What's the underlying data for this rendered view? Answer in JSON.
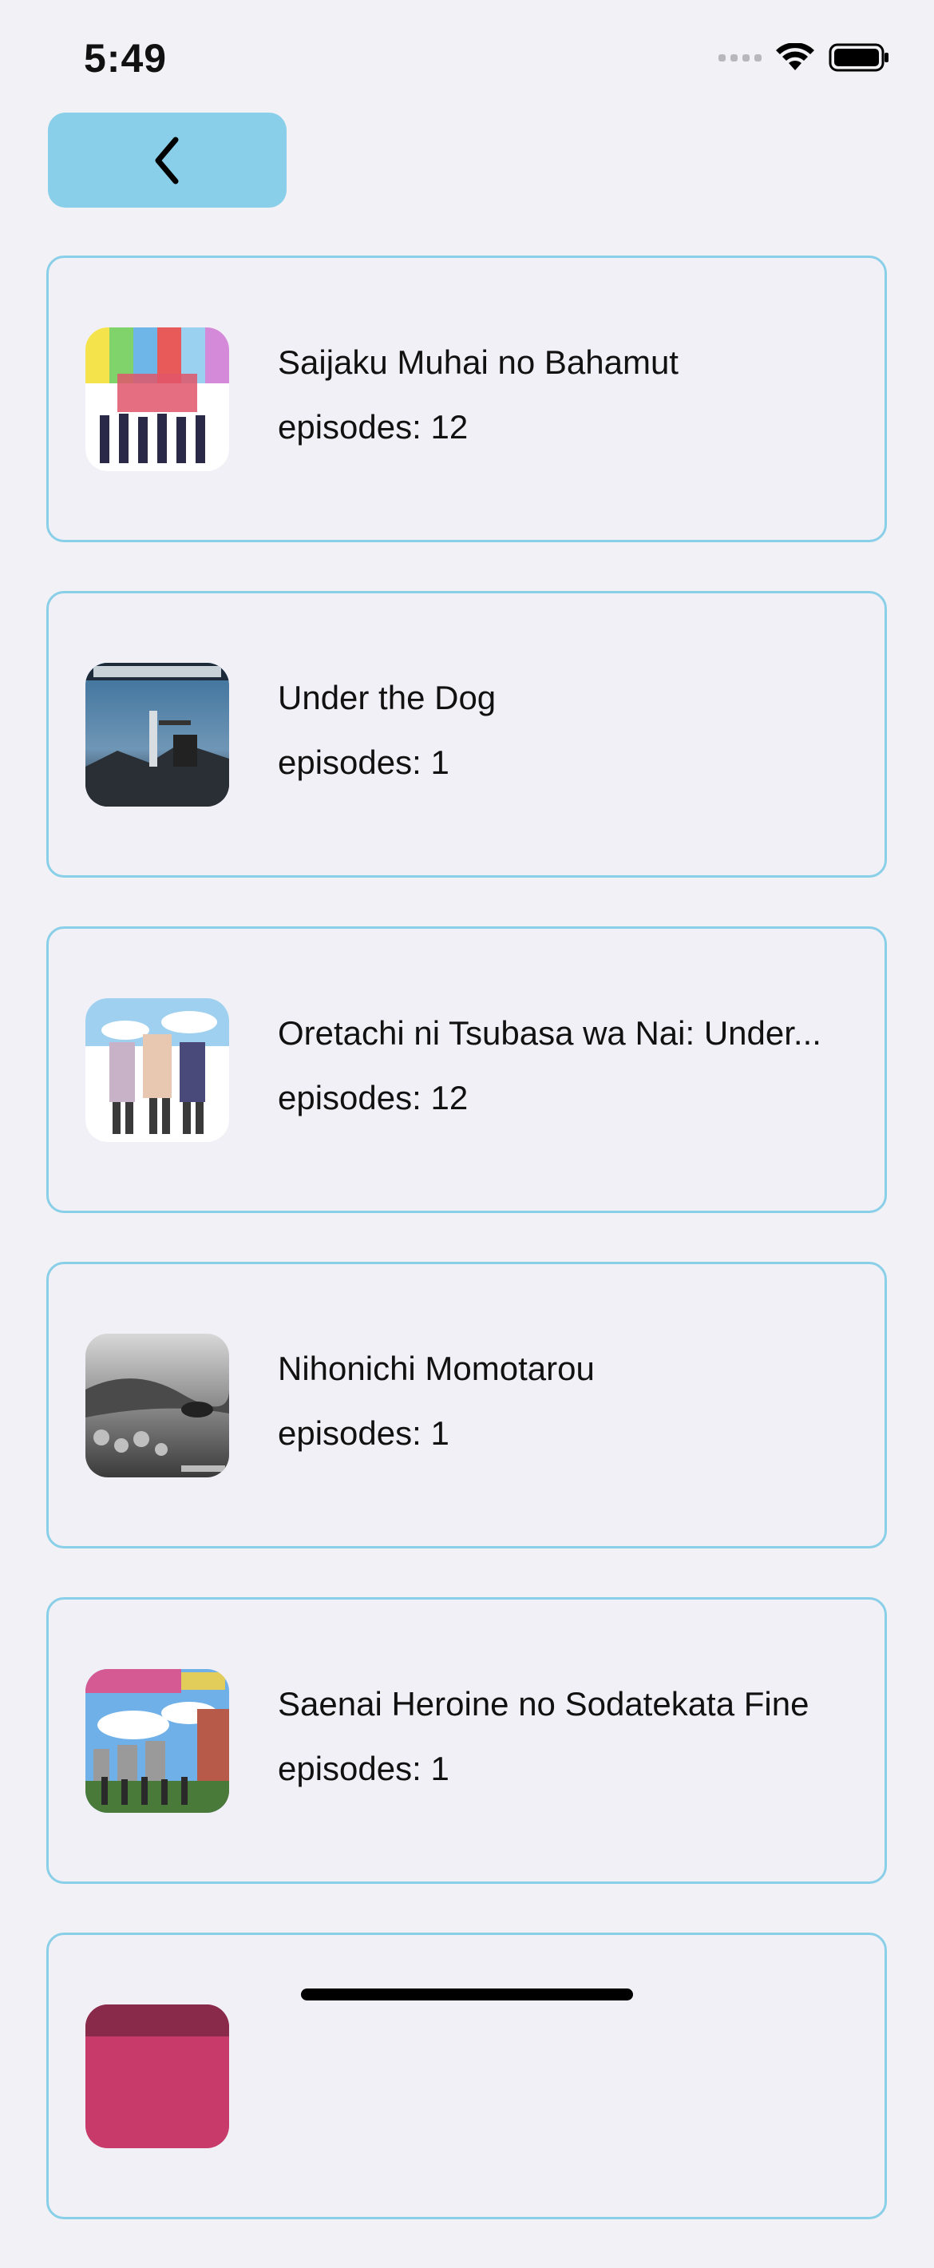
{
  "status_bar": {
    "time": "5:49",
    "icons": [
      "cellular-signal-icon",
      "wifi-icon",
      "battery-icon"
    ]
  },
  "back_button": {
    "icon": "chevron-left-icon",
    "color": "#89cfea"
  },
  "episodes_prefix": "episodes:",
  "items": [
    {
      "title": "Saijaku Muhai no Bahamut",
      "episodes": "episodes: 12",
      "thumbnail": "anime-cover-bahamut"
    },
    {
      "title": "Under the Dog",
      "episodes": "episodes: 1",
      "thumbnail": "anime-cover-under-the-dog"
    },
    {
      "title": "Oretachi ni Tsubasa wa Nai: Under...",
      "episodes": "episodes: 12",
      "thumbnail": "anime-cover-oretachi"
    },
    {
      "title": "Nihonichi Momotarou",
      "episodes": "episodes: 1",
      "thumbnail": "anime-cover-momotarou"
    },
    {
      "title": "Saenai Heroine no Sodatekata Fine",
      "episodes": "episodes: 1",
      "thumbnail": "anime-cover-saenai-fine"
    },
    {
      "title": "",
      "episodes": "",
      "thumbnail": "anime-cover-partial"
    }
  ],
  "colors": {
    "accent": "#89cfea",
    "card_border": "#8acfe8",
    "card_background": "#f0f0f6",
    "page_background": "#f2f2f6"
  }
}
